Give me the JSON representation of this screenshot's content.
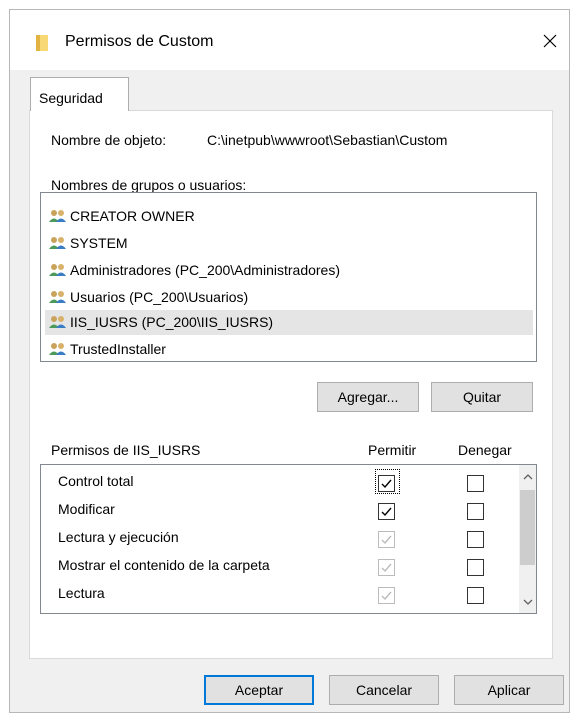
{
  "window": {
    "title": "Permisos de Custom"
  },
  "tabs": [
    {
      "label": "Seguridad"
    }
  ],
  "object": {
    "label": "Nombre de objeto:",
    "value": "C:\\inetpub\\wwwroot\\Sebastian\\Custom"
  },
  "groups": {
    "label": "Nombres de grupos o usuarios:",
    "items": [
      {
        "name": "CREATOR OWNER"
      },
      {
        "name": "SYSTEM"
      },
      {
        "name": "Administradores (PC_200\\Administradores)"
      },
      {
        "name": "Usuarios (PC_200\\Usuarios)"
      },
      {
        "name": "IIS_IUSRS (PC_200\\IIS_IUSRS)"
      },
      {
        "name": "TrustedInstaller"
      }
    ],
    "selected": "IIS_IUSRS (PC_200\\IIS_IUSRS)"
  },
  "group_buttons": {
    "add": "Agregar...",
    "remove": "Quitar"
  },
  "permissions": {
    "label": "Permisos de IIS_IUSRS",
    "allow_header": "Permitir",
    "deny_header": "Denegar",
    "rows": [
      {
        "name": "Control total",
        "allow": true,
        "allow_disabled": false,
        "deny": false
      },
      {
        "name": "Modificar",
        "allow": true,
        "allow_disabled": false,
        "deny": false
      },
      {
        "name": "Lectura y ejecución",
        "allow": true,
        "allow_disabled": true,
        "deny": false
      },
      {
        "name": "Mostrar el contenido de la carpeta",
        "allow": true,
        "allow_disabled": true,
        "deny": false
      },
      {
        "name": "Lectura",
        "allow": true,
        "allow_disabled": true,
        "deny": false
      },
      {
        "name": "",
        "allow": true,
        "allow_disabled": true,
        "deny": false
      }
    ]
  },
  "footer": {
    "ok": "Aceptar",
    "cancel": "Cancelar",
    "apply": "Aplicar"
  },
  "colors": {
    "accent": "#0078d7",
    "folder": "#f8d775",
    "selection": "#e5e5e5"
  },
  "icons": {
    "title": "folder-icon",
    "close": "close-icon",
    "user": "user-group-icon",
    "scroll_up": "chevron-up-icon",
    "scroll_down": "chevron-down-icon"
  }
}
